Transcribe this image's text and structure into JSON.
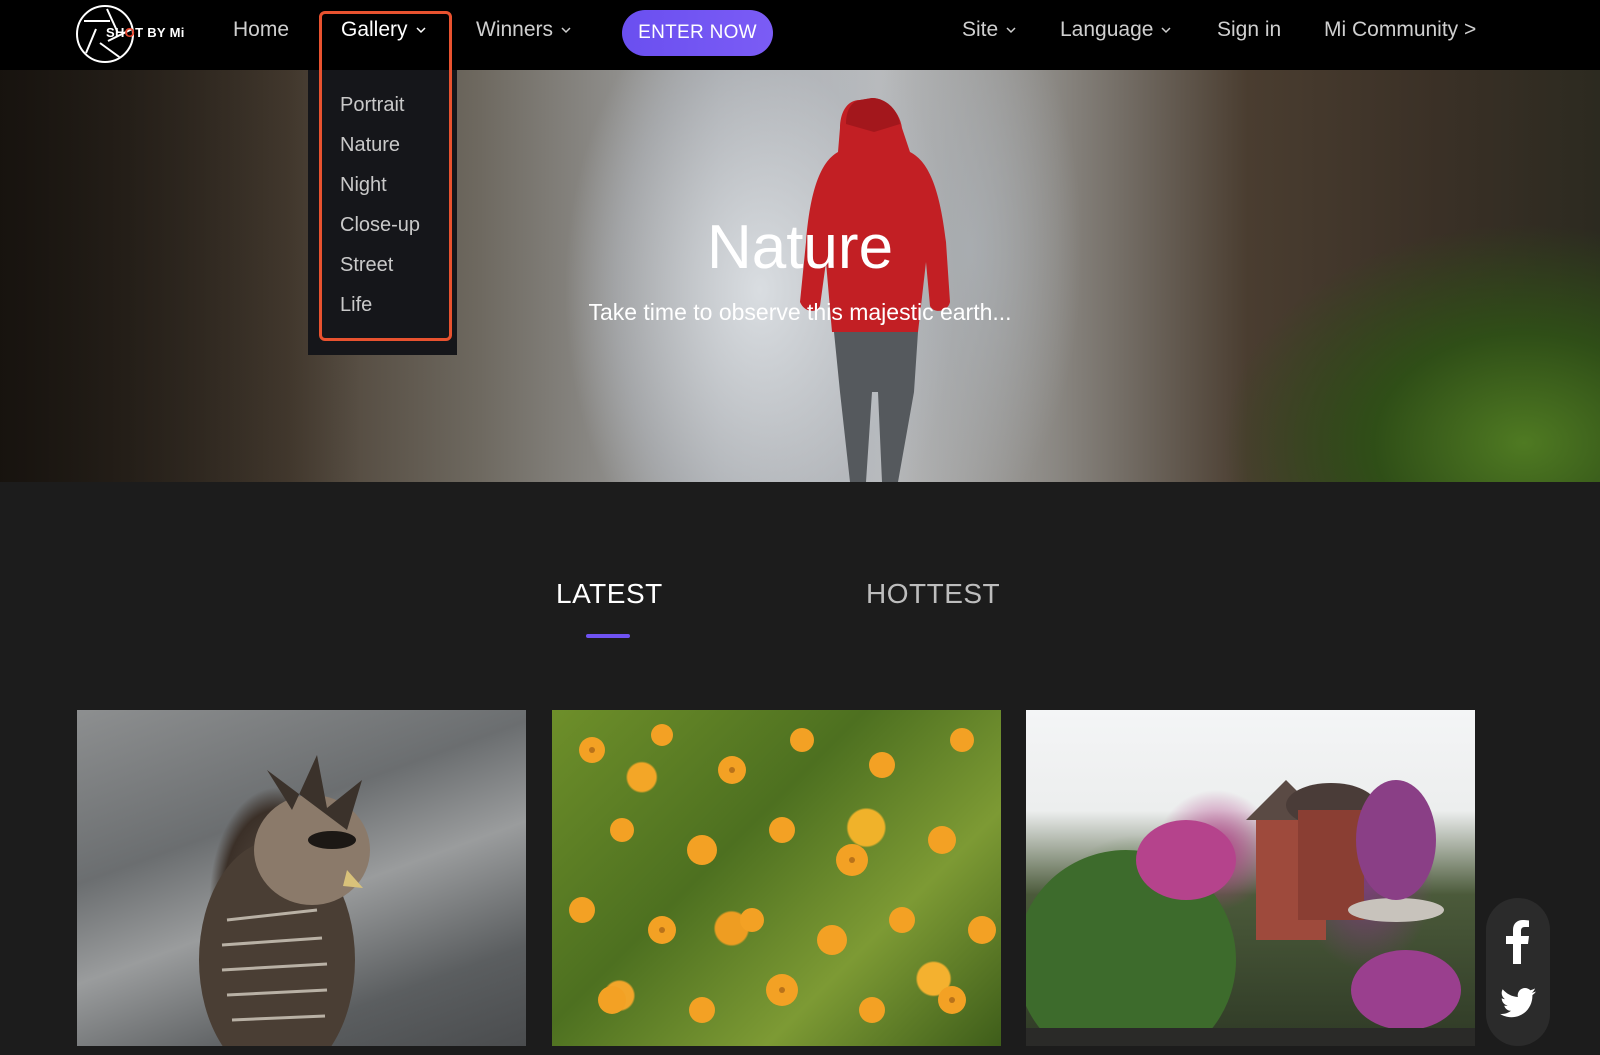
{
  "logo": {
    "text_pre": "SH",
    "text_o": "O",
    "text_post": "T BY Mi"
  },
  "nav": {
    "home": "Home",
    "gallery": "Gallery",
    "winners": "Winners",
    "enter_now": "ENTER NOW",
    "site": "Site",
    "language": "Language",
    "sign_in": "Sign in",
    "community": "Mi Community >"
  },
  "gallery_menu": [
    "Portrait",
    "Nature",
    "Night",
    "Close-up",
    "Street",
    "Life"
  ],
  "hero": {
    "title": "Nature",
    "subtitle": "Take time to observe this majestic earth..."
  },
  "tabs": {
    "latest": "LATEST",
    "hottest": "HOTTEST",
    "active": "LATEST"
  },
  "colors": {
    "accent": "#6f52f2",
    "highlight": "#e8522f",
    "nav_bg": "#000000",
    "page_bg": "#1c1c1c"
  },
  "icons": [
    "chevron-down-icon",
    "facebook-icon",
    "twitter-icon"
  ]
}
